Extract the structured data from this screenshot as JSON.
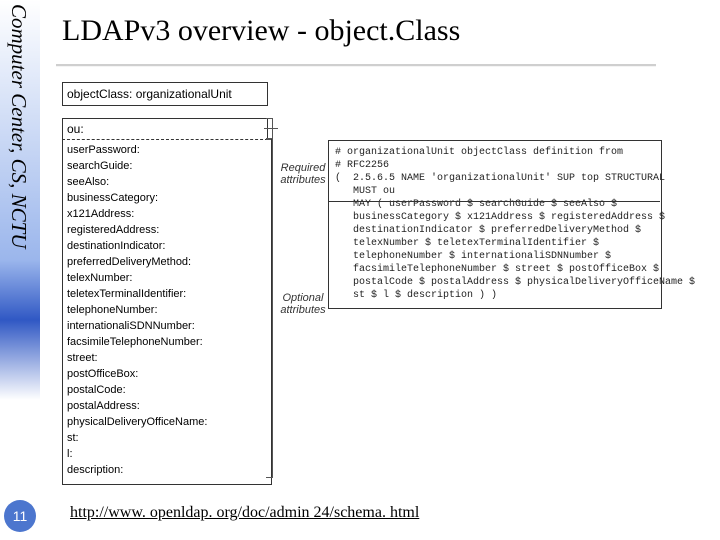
{
  "sidebar": {
    "org": "Computer Center, CS, NCTU",
    "page_number": "11"
  },
  "title": "LDAPv3 overview - object.Class",
  "footer_url": "http://www. openldap. org/doc/admin 24/schema. html",
  "diagram": {
    "objectclass_header": "objectClass: organizationalUnit",
    "required_attribute": "ou:",
    "required_label": "Required\nattributes",
    "optional_label": "Optional\nattributes",
    "optional_attributes": [
      "userPassword:",
      "searchGuide:",
      "seeAlso:",
      "businessCategory:",
      "x121Address:",
      "registeredAddress:",
      "destinationIndicator:",
      "preferredDeliveryMethod:",
      "telexNumber:",
      "teletexTerminalIdentifier:",
      "telephoneNumber:",
      "internationaliSDNNumber:",
      "facsimileTelephoneNumber:",
      "street:",
      "postOfficeBox:",
      "postalCode:",
      "postalAddress:",
      "physicalDeliveryOfficeName:",
      "st:",
      "l:",
      "description:"
    ],
    "code": "# organizationalUnit objectClass definition from\n# RFC2256\n(  2.5.6.5 NAME 'organizationalUnit' SUP top STRUCTURAL\n   MUST ou\n   MAY ( userPassword $ searchGuide $ seeAlso $\n   businessCategory $ x121Address $ registeredAddress $\n   destinationIndicator $ preferredDeliveryMethod $\n   telexNumber $ teletexTerminalIdentifier $\n   telephoneNumber $ internationaliSDNNumber $\n   facsimileTelephoneNumber $ street $ postOfficeBox $\n   postalCode $ postalAddress $ physicalDeliveryOfficeName $\n   st $ l $ description ) )"
  }
}
